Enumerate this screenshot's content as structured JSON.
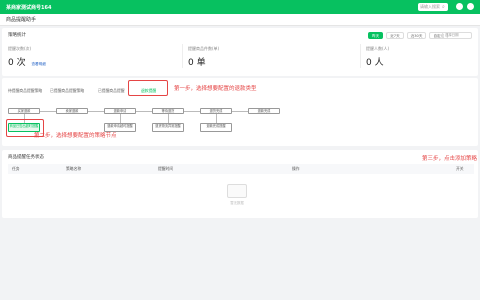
{
  "topbar": {
    "title": "某商家测试商号164",
    "search_placeholder": "请输入搜索"
  },
  "subheader": {
    "title": "商品提醒助手"
  },
  "summary": {
    "title": "策略统计",
    "filters": [
      "昨天",
      "近7天",
      "近30天",
      "自定义"
    ],
    "active_filter_index": 0,
    "date_placeholder": "选择日期",
    "stats": [
      {
        "label": "提醒次数(次)",
        "value": "0 次",
        "link": "查看明细"
      },
      {
        "label": "提醒商品件数(单)",
        "value": "0 单"
      },
      {
        "label": "提醒人数(人)",
        "value": "0 人"
      }
    ]
  },
  "strategy": {
    "tabs": [
      "待提醒商品提醒策略",
      "已提醒商品提醒策略",
      "已提醒商品提醒",
      "退款提醒"
    ],
    "active_tab_index": 3,
    "annotation1": "第一步，选择想要配置的退款类型",
    "flow_top": [
      "买家退款",
      "卖家退款",
      "退款申请",
      "等待退货",
      "退货完成",
      "退款完成"
    ],
    "flow_sub": [
      {
        "label": "商品已售出超时提醒"
      },
      {
        "label": "退款申请超时提醒"
      },
      {
        "label": "退货物流异常提醒"
      },
      {
        "label": "退款完成提醒"
      }
    ],
    "active_sub_label": "商品已售出超时提醒",
    "annotation2": "第二步，选择想要配置的策略节点"
  },
  "records": {
    "title": "商品提醒任务状态",
    "annotation3": "第三步，点击添加策略",
    "columns": [
      "任务",
      "策略名称",
      "提醒时间",
      "操作",
      "开关"
    ],
    "empty_text": "暂无数据"
  },
  "colors": {
    "brand": "#07c160",
    "annotation": "#e54545",
    "link": "#1e5fc4"
  }
}
